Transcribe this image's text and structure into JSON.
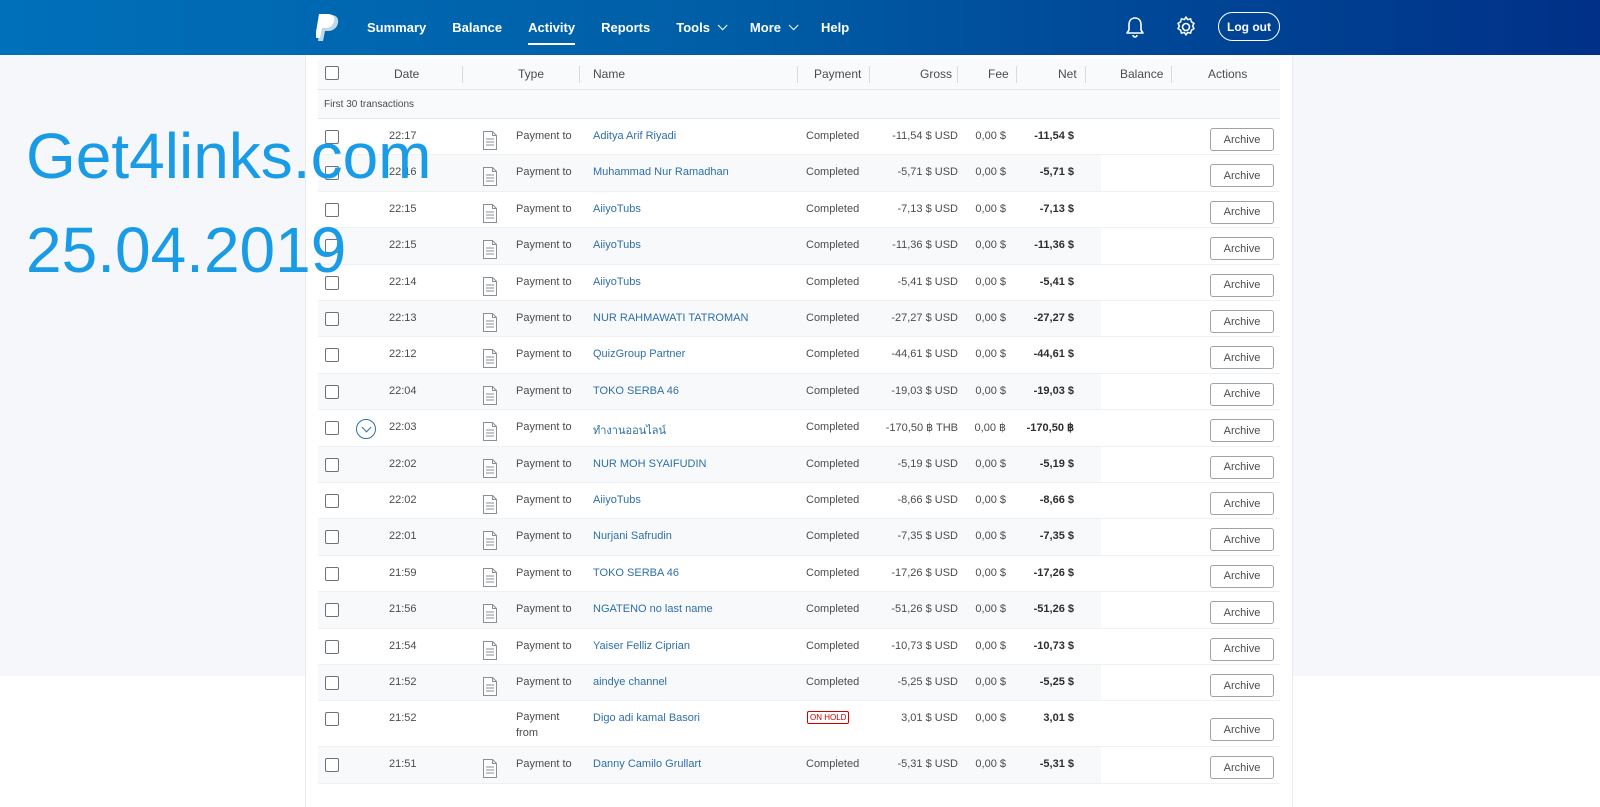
{
  "header": {
    "nav": [
      {
        "label": "Summary",
        "dropdown": false,
        "active": false
      },
      {
        "label": "Balance",
        "dropdown": false,
        "active": false
      },
      {
        "label": "Activity",
        "dropdown": false,
        "active": true
      },
      {
        "label": "Reports",
        "dropdown": false,
        "active": false
      },
      {
        "label": "Tools",
        "dropdown": true,
        "active": false
      },
      {
        "label": "More",
        "dropdown": true,
        "active": false
      },
      {
        "label": "Help",
        "dropdown": false,
        "active": false
      }
    ],
    "logout_label": "Log out"
  },
  "table": {
    "columns": {
      "date": "Date",
      "type": "Type",
      "name": "Name",
      "payment": "Payment",
      "gross": "Gross",
      "fee": "Fee",
      "net": "Net",
      "balance": "Balance",
      "actions": "Actions"
    },
    "subheader": "First 30 transactions",
    "archive_label": "Archive",
    "rows": [
      {
        "time": "22:17",
        "type": "Payment to",
        "name": "Aditya Arif Riyadi",
        "status": "Completed",
        "gross": "-11,54 $ USD",
        "fee": "0,00 $",
        "net": "-11,54 $"
      },
      {
        "time": "22:16",
        "type": "Payment to",
        "name": "Muhammad Nur Ramadhan",
        "status": "Completed",
        "gross": "-5,71 $ USD",
        "fee": "0,00 $",
        "net": "-5,71 $"
      },
      {
        "time": "22:15",
        "type": "Payment to",
        "name": "AiiyoTubs",
        "status": "Completed",
        "gross": "-7,13 $ USD",
        "fee": "0,00 $",
        "net": "-7,13 $"
      },
      {
        "time": "22:15",
        "type": "Payment to",
        "name": "AiiyoTubs",
        "status": "Completed",
        "gross": "-11,36 $ USD",
        "fee": "0,00 $",
        "net": "-11,36 $"
      },
      {
        "time": "22:14",
        "type": "Payment to",
        "name": "AiiyoTubs",
        "status": "Completed",
        "gross": "-5,41 $ USD",
        "fee": "0,00 $",
        "net": "-5,41 $"
      },
      {
        "time": "22:13",
        "type": "Payment to",
        "name": "NUR RAHMAWATI TATROMAN",
        "status": "Completed",
        "gross": "-27,27 $ USD",
        "fee": "0,00 $",
        "net": "-27,27 $"
      },
      {
        "time": "22:12",
        "type": "Payment to",
        "name": "QuizGroup Partner",
        "status": "Completed",
        "gross": "-44,61 $ USD",
        "fee": "0,00 $",
        "net": "-44,61 $"
      },
      {
        "time": "22:04",
        "type": "Payment to",
        "name": "TOKO SERBA 46",
        "status": "Completed",
        "gross": "-19,03 $ USD",
        "fee": "0,00 $",
        "net": "-19,03 $"
      },
      {
        "time": "22:03",
        "type": "Payment to",
        "name": "ทำงานออนไลน์",
        "status": "Completed",
        "gross": "-170,50 ฿ THB",
        "fee": "0,00 ฿",
        "net": "-170,50 ฿",
        "expand": true
      },
      {
        "time": "22:02",
        "type": "Payment to",
        "name": "NUR MOH SYAIFUDIN",
        "status": "Completed",
        "gross": "-5,19 $ USD",
        "fee": "0,00 $",
        "net": "-5,19 $"
      },
      {
        "time": "22:02",
        "type": "Payment to",
        "name": "AiiyoTubs",
        "status": "Completed",
        "gross": "-8,66 $ USD",
        "fee": "0,00 $",
        "net": "-8,66 $"
      },
      {
        "time": "22:01",
        "type": "Payment to",
        "name": "Nurjani Safrudin",
        "status": "Completed",
        "gross": "-7,35 $ USD",
        "fee": "0,00 $",
        "net": "-7,35 $"
      },
      {
        "time": "21:59",
        "type": "Payment to",
        "name": "TOKO SERBA 46",
        "status": "Completed",
        "gross": "-17,26 $ USD",
        "fee": "0,00 $",
        "net": "-17,26 $"
      },
      {
        "time": "21:56",
        "type": "Payment to",
        "name": "NGATENO no last name",
        "status": "Completed",
        "gross": "-51,26 $ USD",
        "fee": "0,00 $",
        "net": "-51,26 $"
      },
      {
        "time": "21:54",
        "type": "Payment to",
        "name": "Yaiser Felliz Ciprian",
        "status": "Completed",
        "gross": "-10,73 $ USD",
        "fee": "0,00 $",
        "net": "-10,73 $"
      },
      {
        "time": "21:52",
        "type": "Payment to",
        "name": "aindye channel",
        "status": "Completed",
        "gross": "-5,25 $ USD",
        "fee": "0,00 $",
        "net": "-5,25 $"
      },
      {
        "time": "21:52",
        "type": "Payment",
        "type2": "from",
        "name": "Digo adi kamal Basori",
        "status": "ON HOLD",
        "hold": true,
        "gross": "3,01 $ USD",
        "fee": "0,00 $",
        "net": "3,01 $",
        "tall": true
      },
      {
        "time": "21:51",
        "type": "Payment to",
        "name": "Danny Camilo Grullart",
        "status": "Completed",
        "gross": "-5,31 $ USD",
        "fee": "0,00 $",
        "net": "-5,31 $"
      }
    ]
  },
  "watermark": {
    "line1": "Get4links.com",
    "line2": "25.04.2019",
    "color": "#1a9be6"
  },
  "colors": {
    "header_start": "#0070ba",
    "header_end": "#003087",
    "link": "#2f6fa8",
    "hold": "#d20000"
  }
}
